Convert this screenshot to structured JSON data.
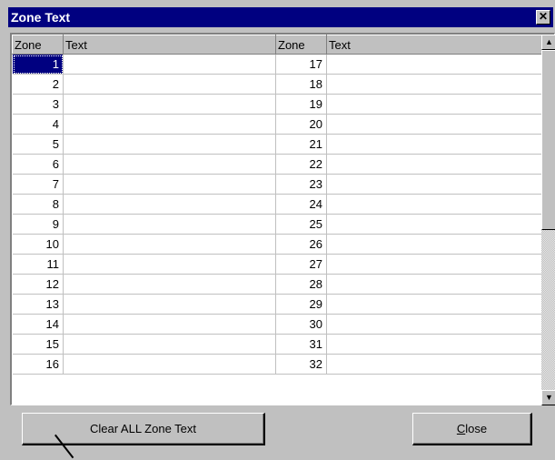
{
  "window": {
    "title": "Zone Text"
  },
  "table": {
    "headers": [
      "Zone",
      "Text",
      "Zone",
      "Text"
    ],
    "rows": [
      {
        "zone_a": "1",
        "text_a": "",
        "zone_b": "17",
        "text_b": ""
      },
      {
        "zone_a": "2",
        "text_a": "",
        "zone_b": "18",
        "text_b": ""
      },
      {
        "zone_a": "3",
        "text_a": "",
        "zone_b": "19",
        "text_b": ""
      },
      {
        "zone_a": "4",
        "text_a": "",
        "zone_b": "20",
        "text_b": ""
      },
      {
        "zone_a": "5",
        "text_a": "",
        "zone_b": "21",
        "text_b": ""
      },
      {
        "zone_a": "6",
        "text_a": "",
        "zone_b": "22",
        "text_b": ""
      },
      {
        "zone_a": "7",
        "text_a": "",
        "zone_b": "23",
        "text_b": ""
      },
      {
        "zone_a": "8",
        "text_a": "",
        "zone_b": "24",
        "text_b": ""
      },
      {
        "zone_a": "9",
        "text_a": "",
        "zone_b": "25",
        "text_b": ""
      },
      {
        "zone_a": "10",
        "text_a": "",
        "zone_b": "26",
        "text_b": ""
      },
      {
        "zone_a": "11",
        "text_a": "",
        "zone_b": "27",
        "text_b": ""
      },
      {
        "zone_a": "12",
        "text_a": "",
        "zone_b": "28",
        "text_b": ""
      },
      {
        "zone_a": "13",
        "text_a": "",
        "zone_b": "29",
        "text_b": ""
      },
      {
        "zone_a": "14",
        "text_a": "",
        "zone_b": "30",
        "text_b": ""
      },
      {
        "zone_a": "15",
        "text_a": "",
        "zone_b": "31",
        "text_b": ""
      },
      {
        "zone_a": "16",
        "text_a": "",
        "zone_b": "32",
        "text_b": ""
      }
    ],
    "selected_cell": "1"
  },
  "buttons": {
    "clear_label": "Clear ALL Zone Text",
    "close_prefix": "",
    "close_mnemonic": "C",
    "close_rest": "lose"
  },
  "icons": {
    "close": "close-icon",
    "scroll_up": "arrow-up-icon",
    "scroll_down": "arrow-down-icon"
  },
  "colors": {
    "titlebar": "#000080",
    "selection": "#000080",
    "face": "#c0c0c0"
  }
}
